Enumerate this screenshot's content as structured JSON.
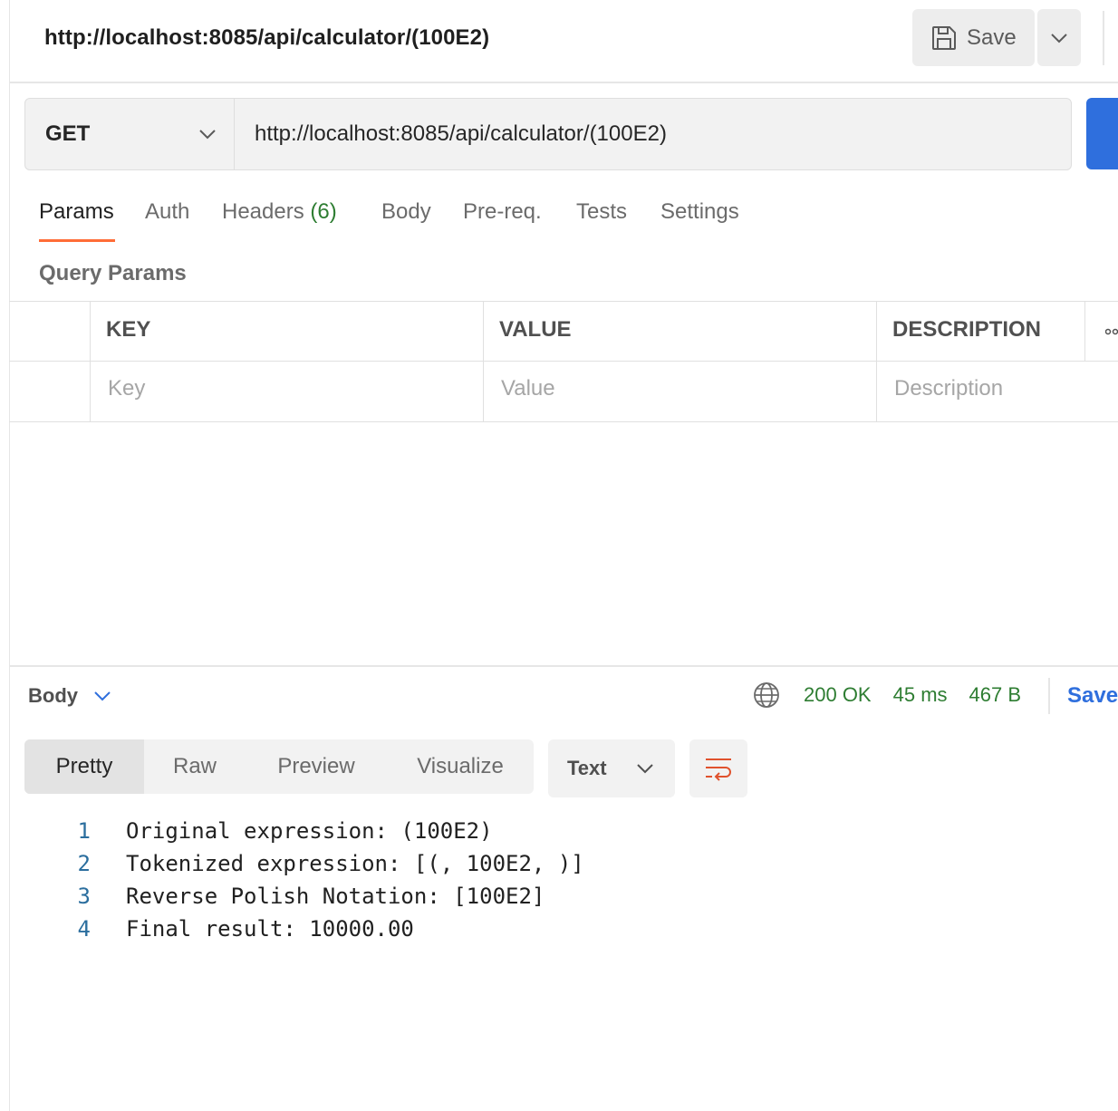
{
  "request": {
    "title": "http://localhost:8085/api/calculator/(100E2)",
    "save_label": "Save",
    "method": "GET",
    "url": "http://localhost:8085/api/calculator/(100E2)"
  },
  "tabs": [
    {
      "label": "Params",
      "active": true
    },
    {
      "label": "Auth"
    },
    {
      "label": "Headers",
      "count": "(6)"
    },
    {
      "label": "Body"
    },
    {
      "label": "Pre-req."
    },
    {
      "label": "Tests"
    },
    {
      "label": "Settings"
    }
  ],
  "query_params": {
    "title": "Query Params",
    "columns": [
      "KEY",
      "VALUE",
      "DESCRIPTION"
    ],
    "placeholders": [
      "Key",
      "Value",
      "Description"
    ]
  },
  "response": {
    "body_label": "Body",
    "status": "200 OK",
    "time": "45 ms",
    "size": "467 B",
    "save_label": "Save",
    "view_modes": [
      "Pretty",
      "Raw",
      "Preview",
      "Visualize"
    ],
    "active_view": "Pretty",
    "format": "Text",
    "lines": [
      {
        "n": "1",
        "text": "Original expression: (100E2)"
      },
      {
        "n": "2",
        "text": "Tokenized expression: [(, 100E2, )]"
      },
      {
        "n": "3",
        "text": "Reverse Polish Notation: [100E2]"
      },
      {
        "n": "4",
        "text": "Final result: 10000.00"
      }
    ]
  },
  "colors": {
    "accent_tab": "#ff6c37",
    "send_button": "#2f6fdd",
    "status_ok": "#2e7d32",
    "line_number": "#2b6e9e"
  }
}
